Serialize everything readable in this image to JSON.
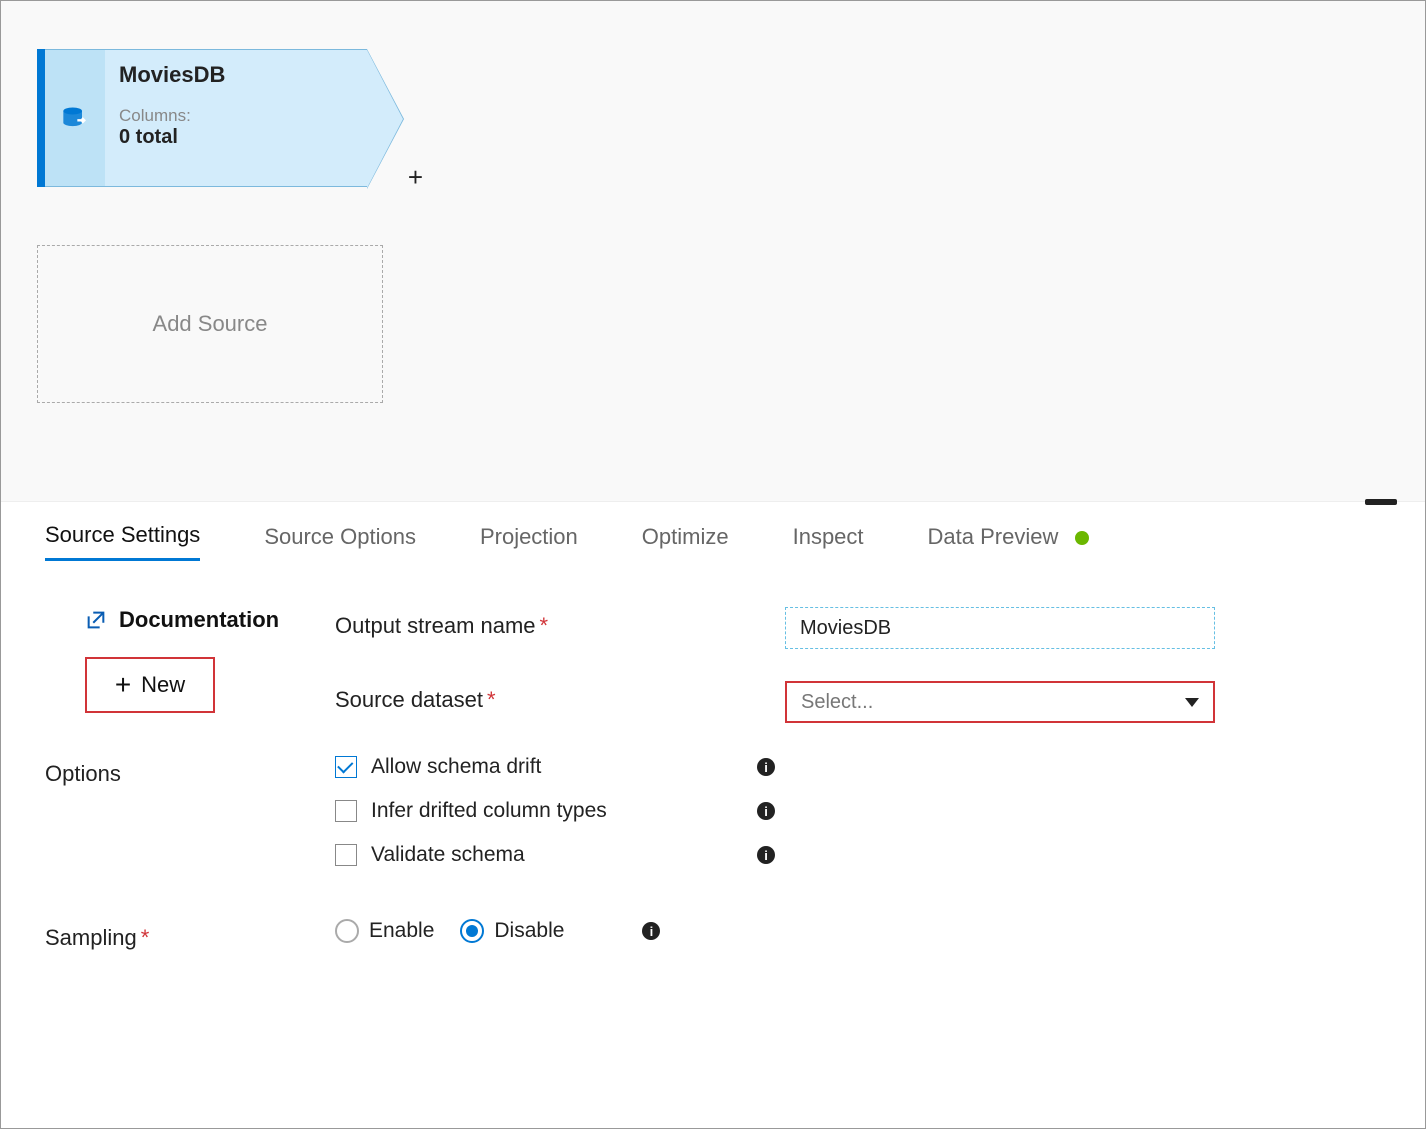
{
  "canvas": {
    "source_node": {
      "title": "MoviesDB",
      "columns_label": "Columns:",
      "columns_count": "0 total"
    },
    "add_source_label": "Add Source",
    "plus_symbol": "+"
  },
  "tabs": [
    {
      "label": "Source Settings",
      "active": true
    },
    {
      "label": "Source Options",
      "active": false
    },
    {
      "label": "Projection",
      "active": false
    },
    {
      "label": "Optimize",
      "active": false
    },
    {
      "label": "Inspect",
      "active": false
    },
    {
      "label": "Data Preview",
      "active": false,
      "has_dot": true
    }
  ],
  "form": {
    "output_stream_name": {
      "label": "Output stream name",
      "value": "MoviesDB"
    },
    "source_dataset": {
      "label": "Source dataset",
      "placeholder": "Select..."
    },
    "documentation_label": "Documentation",
    "new_button_label": "New",
    "options": {
      "label": "Options",
      "items": [
        {
          "label": "Allow schema drift",
          "checked": true
        },
        {
          "label": "Infer drifted column types",
          "checked": false
        },
        {
          "label": "Validate schema",
          "checked": false
        }
      ]
    },
    "sampling": {
      "label": "Sampling",
      "enable_label": "Enable",
      "disable_label": "Disable",
      "selected": "disable"
    }
  }
}
